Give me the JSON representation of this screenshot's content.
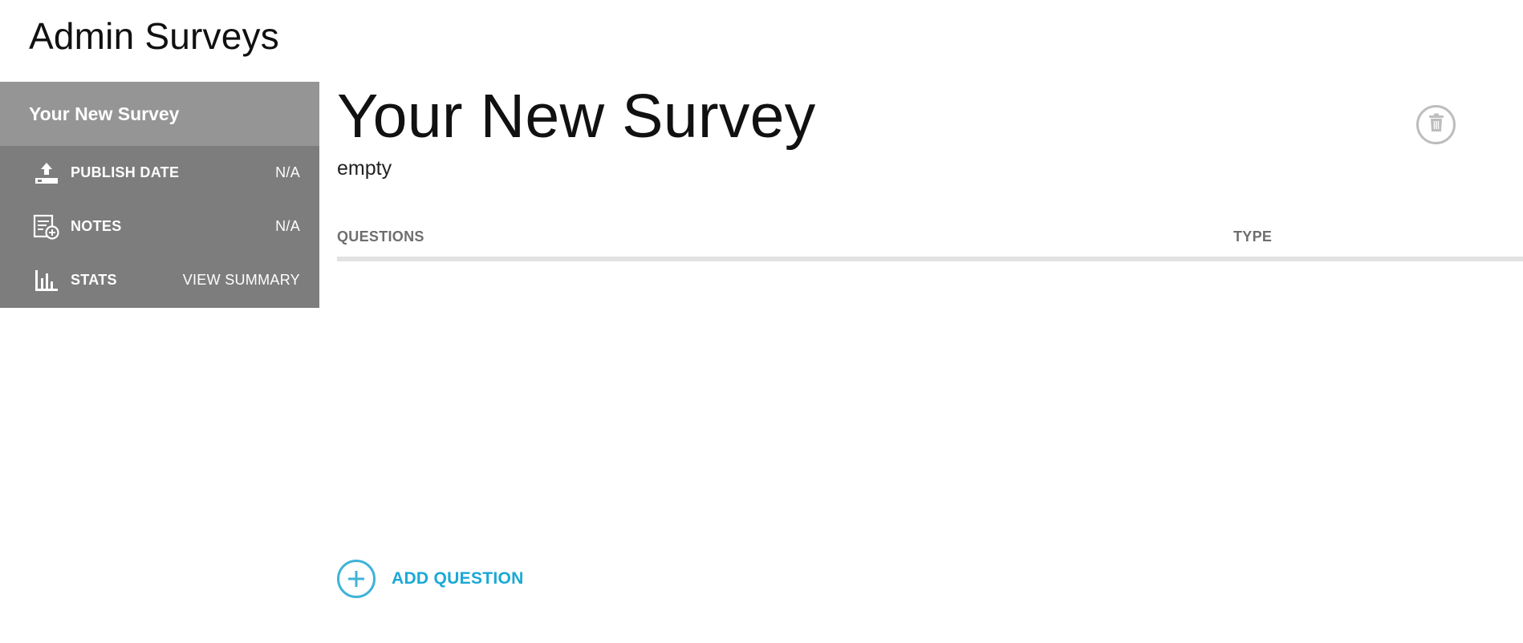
{
  "header": {
    "title": "Admin Surveys"
  },
  "sidebar": {
    "title": "Your New Survey",
    "items": [
      {
        "icon": "upload-icon",
        "label": "PUBLISH DATE",
        "value": "N/A"
      },
      {
        "icon": "notes-add-icon",
        "label": "NOTES",
        "value": "N/A"
      },
      {
        "icon": "bar-chart-icon",
        "label": "STATS",
        "value": "VIEW SUMMARY"
      }
    ]
  },
  "main": {
    "title": "Your New Survey",
    "subtitle": "empty",
    "delete_icon": "trash-icon",
    "table": {
      "columns": [
        "QUESTIONS",
        "TYPE"
      ],
      "rows": []
    },
    "add_question": {
      "icon": "plus-circle-icon",
      "label": "ADD QUESTION"
    }
  },
  "colors": {
    "sidebar_bg": "#7d7d7d",
    "sidebar_title_bg": "#959595",
    "accent": "#19a9d6",
    "column_header": "#6e6e6e",
    "rule": "#e2e2e2"
  }
}
